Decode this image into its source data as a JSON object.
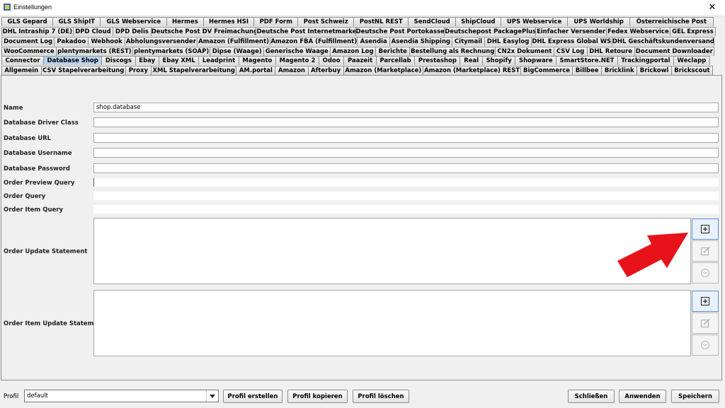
{
  "window": {
    "title": "Einstellungen",
    "close_glyph": "✕"
  },
  "tab_rows": [
    [
      "GLS Gepard",
      "GLS ShipIT",
      "GLS Webservice",
      "Hermes",
      "Hermes HSI",
      "PDF Form",
      "Post Schweiz",
      "PostNL REST",
      "SendCloud",
      "ShipCloud",
      "UPS Webservice",
      "UPS Worldship",
      "Österreichische Post"
    ],
    [
      "DHL Intraship 7 (DE)",
      "DPD Cloud",
      "DPD Delis",
      "Deutsche Post DV Freimachung",
      "Deutsche Post Internetmarke",
      "Deutsche Post Portokasse",
      "Deutschepost PackagePlus",
      "Einfacher Versender",
      "Fedex Webservice",
      "GEL Express"
    ],
    [
      "Document Log",
      "Pakadoo",
      "Webhook",
      "Abholungsversender",
      "Amazon (Fulfillment)",
      "Amazon FBA (Fulfillment)",
      "Asendia",
      "Asendia Shipping",
      "Citymail",
      "DHL Easylog",
      "DHL Express Global WS",
      "DHL Geschäftskundenversand"
    ],
    [
      "WooCommerce",
      "plentymarkets (REST)",
      "plentymarkets (SOAP)",
      "Dipse (Waage)",
      "Generische Waage",
      "Amazon Log",
      "Berichte",
      "Bestellung als Rechnung",
      "CN2x Dokument",
      "CSV Log",
      "DHL Retoure",
      "Document Downloader"
    ],
    [
      "Connector",
      "Database Shop",
      "Discogs",
      "Ebay",
      "Ebay XML",
      "Leadprint",
      "Magento",
      "Magento 2",
      "Odoo",
      "Paazeit",
      "Parcellab",
      "Prestashop",
      "Real",
      "Shopify",
      "Shopware",
      "SmartStore.NET",
      "Trackingportal",
      "Weclapp"
    ],
    [
      "Allgemein",
      "CSV Stapelverarbeitung",
      "Proxy",
      "XML Stapelverarbeitung",
      "AM.portal",
      "Amazon",
      "Afterbuy",
      "Amazon (Marketplace)",
      "Amazon (Marketplace) REST",
      "BigCommerce",
      "Billbee",
      "Bricklink",
      "Brickowl",
      "Brickscout"
    ]
  ],
  "active_tab": "Database Shop",
  "form": {
    "name_label": "Name",
    "name_value": "shop.database",
    "driver_label": "Database Driver Class",
    "driver_value": "",
    "url_label": "Database URL",
    "url_value": "",
    "username_label": "Database Username",
    "username_value": "",
    "password_label": "Database Password",
    "password_value": "",
    "order_preview_label": "Order Preview Query",
    "order_query_label": "Order Query",
    "order_item_query_label": "Order Item Query",
    "order_update_label": "Order Update Statement",
    "order_item_update_label": "Order Item Update Statement"
  },
  "bottom": {
    "profil_label": "Profil",
    "profil_value": "default",
    "create_label": "Profil erstellen",
    "copy_label": "Profil kopieren",
    "delete_label": "Profil löschen",
    "close_label": "Schließen",
    "apply_label": "Anwenden",
    "save_label": "Speichern"
  },
  "colors": {
    "active_tab": "#b8d1ea",
    "arrow": "#e8131a",
    "primary_border": "#5b8ed6"
  },
  "icons": [
    "app-icon",
    "close-icon",
    "add-icon",
    "edit-icon",
    "remove-icon",
    "dropdown-arrow-icon",
    "red-arrow-icon"
  ]
}
